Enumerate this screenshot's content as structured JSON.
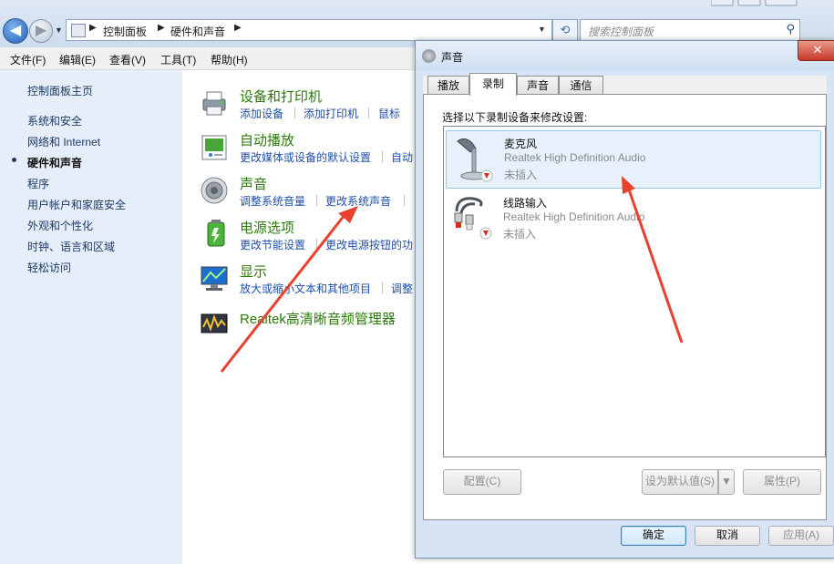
{
  "explorer": {
    "breadcrumb": [
      "控制面板",
      "硬件和声音"
    ],
    "search_placeholder": "搜索控制面板",
    "menu": [
      "文件(F)",
      "编辑(E)",
      "查看(V)",
      "工具(T)",
      "帮助(H)"
    ],
    "left_nav": [
      {
        "label": "控制面板主页"
      },
      {
        "label": "系统和安全"
      },
      {
        "label": "网络和 Internet"
      },
      {
        "label": "硬件和声音",
        "current": true
      },
      {
        "label": "程序"
      },
      {
        "label": "用户帐户和家庭安全"
      },
      {
        "label": "外观和个性化"
      },
      {
        "label": "时钟、语言和区域"
      },
      {
        "label": "轻松访问"
      }
    ],
    "categories": [
      {
        "title": "设备和打印机",
        "icon": "printer-icon",
        "links": [
          "添加设备",
          "添加打印机",
          "鼠标"
        ]
      },
      {
        "title": "自动播放",
        "icon": "autoplay-icon",
        "links": [
          "更改媒体或设备的默认设置",
          "自动"
        ]
      },
      {
        "title": "声音",
        "icon": "speaker-icon",
        "links": [
          "调整系统音量",
          "更改系统声音"
        ]
      },
      {
        "title": "电源选项",
        "icon": "battery-icon",
        "links": [
          "更改节能设置",
          "更改电源按钮的功"
        ]
      },
      {
        "title": "显示",
        "icon": "display-icon",
        "links": [
          "放大或缩小文本和其他项目",
          "调整"
        ]
      },
      {
        "title": "Realtek高清晰音频管理器",
        "icon": "realtek-icon",
        "links": []
      }
    ]
  },
  "dialog": {
    "title": "声音",
    "tabs": [
      "播放",
      "录制",
      "声音",
      "通信"
    ],
    "active_tab": "录制",
    "instruction": "选择以下录制设备来修改设置:",
    "devices": [
      {
        "name": "麦克风",
        "desc": "Realtek High Definition Audio",
        "status": "未插入",
        "icon": "microphone-icon",
        "selected": true
      },
      {
        "name": "线路输入",
        "desc": "Realtek High Definition Audio",
        "status": "未插入",
        "icon": "line-in-cable-icon",
        "selected": false
      }
    ],
    "buttons": {
      "configure": "配置(C)",
      "set_default": "设为默认值(S)",
      "properties": "属性(P)",
      "ok": "确定",
      "cancel": "取消",
      "apply": "应用(A)"
    },
    "close_glyph": "✕"
  },
  "colors": {
    "annotation_arrow": "#e8412e",
    "category_title": "#2b7a0b",
    "link": "#1f4fa8"
  }
}
